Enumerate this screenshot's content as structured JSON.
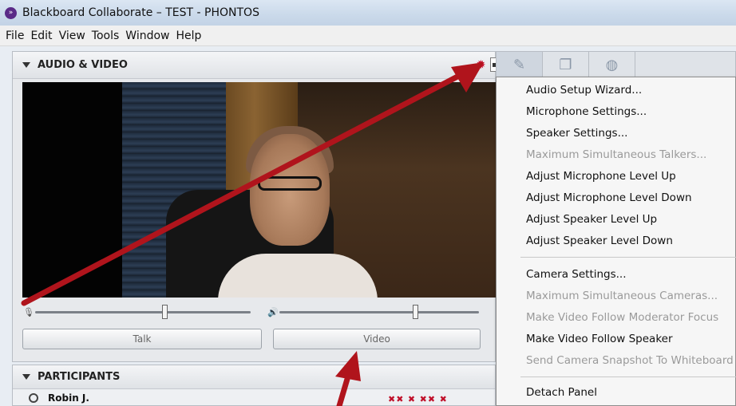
{
  "window": {
    "title": "Blackboard Collaborate – TEST - PHONTOS"
  },
  "menubar": {
    "items": [
      "File",
      "Edit",
      "View",
      "Tools",
      "Window",
      "Help"
    ]
  },
  "audio_video_panel": {
    "title": "AUDIO & VIDEO",
    "talk_label": "Talk",
    "video_label": "Video"
  },
  "participants_panel": {
    "title": "PARTICIPANTS",
    "participants": [
      {
        "name": "Robin J."
      }
    ]
  },
  "options_menu": {
    "items": [
      {
        "label": "Audio Setup Wizard...",
        "enabled": true
      },
      {
        "label": "Microphone Settings...",
        "enabled": true
      },
      {
        "label": "Speaker Settings...",
        "enabled": true
      },
      {
        "label": "Maximum Simultaneous Talkers...",
        "enabled": false
      },
      {
        "label": "Adjust Microphone Level Up",
        "enabled": true
      },
      {
        "label": "Adjust Microphone Level Down",
        "enabled": true
      },
      {
        "label": "Adjust Speaker Level Up",
        "enabled": true
      },
      {
        "label": "Adjust Speaker Level Down",
        "enabled": true
      },
      {
        "label": "Camera Settings...",
        "enabled": true
      },
      {
        "label": "Maximum Simultaneous Cameras...",
        "enabled": false
      },
      {
        "label": "Make Video Follow Moderator Focus",
        "enabled": false
      },
      {
        "label": "Make Video Follow Speaker",
        "enabled": true
      },
      {
        "label": "Send Camera Snapshot To Whiteboard",
        "enabled": false
      },
      {
        "label": "Detach Panel",
        "enabled": true
      }
    ]
  },
  "levels": {
    "microphone_level": 0.6,
    "speaker_level": 0.68
  },
  "colors": {
    "annotation_arrow": "#b0141c",
    "disabled_text": "#9a9a9a",
    "app_icon": "#5a2a87"
  }
}
